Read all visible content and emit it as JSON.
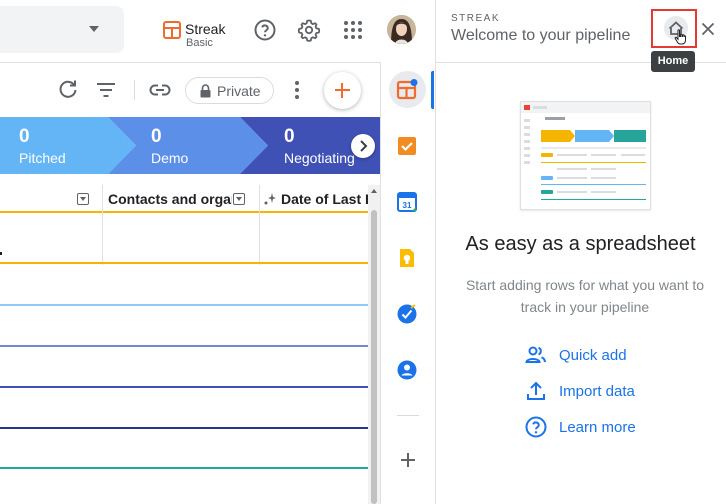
{
  "header": {
    "app_name": "Streak",
    "plan": "Basic"
  },
  "toolbar": {
    "private_label": "Private"
  },
  "stages": [
    {
      "count": "0",
      "label": "Pitched",
      "color": "#64b5f6"
    },
    {
      "count": "0",
      "label": "Demo",
      "color": "#5c8fe8"
    },
    {
      "count": "0",
      "label": "Negotiating",
      "color": "#3f51b5"
    }
  ],
  "table": {
    "columns": [
      "Contacts and organizatio",
      "Date of Last E"
    ],
    "row_line_colors": [
      "#f4b400",
      "#90caf9",
      "#7986cb",
      "#3f51b5",
      "#283593",
      "#26a69a"
    ]
  },
  "panel": {
    "kicker": "STREAK",
    "title": "Welcome to your pipeline",
    "tooltip": "Home",
    "headline": "As easy as a spreadsheet",
    "subline": "Start adding rows for what you want to track in your pipeline",
    "actions": [
      {
        "label": "Quick add",
        "icon": "people-icon"
      },
      {
        "label": "Import data",
        "icon": "upload-icon"
      },
      {
        "label": "Learn more",
        "icon": "help-icon"
      }
    ]
  },
  "colors": {
    "accent": "#1a73e8",
    "streak_orange": "#f06b2e",
    "highlight": "#e53935"
  }
}
